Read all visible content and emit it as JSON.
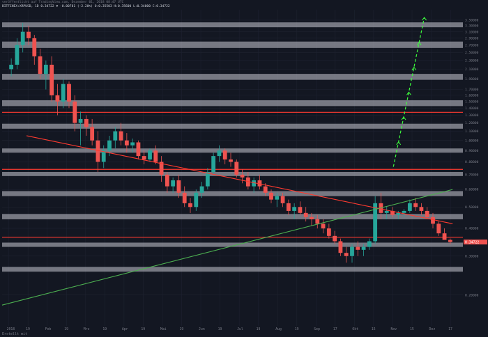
{
  "header": {
    "line1": "veröffentlicht auf TradingView.com, Dezember 01, 2018 08:47 UTC",
    "line2": "BITFINEX:XRPUSD, 1D 0.34722 ▼ -0.00781 (-2.20%) O:0.35503 H:0.35600 L:0.34000 C:0.34722"
  },
  "footer": {
    "note": "Erstellt mit"
  },
  "colors": {
    "background": "#131722",
    "zone": "#c8c8d2",
    "red_line": "#ff3b30",
    "green_line": "#4caf50",
    "arrow": "#3dff3d",
    "up": "#26a69a",
    "down": "#ef5350"
  },
  "price_badges": {
    "top": "3.50000",
    "current": "0.34722"
  },
  "chart_data": {
    "type": "candlestick",
    "symbol": "XRPUSD",
    "exchange": "BITFINEX",
    "timeframe": "1D",
    "yscale": "log",
    "ylim": [
      0.145,
      3.9
    ],
    "x_ticks": [
      "2018",
      "19",
      "Feb",
      "19",
      "Mrz",
      "19",
      "Apr",
      "19",
      "Mai",
      "19",
      "Jun",
      "19",
      "Jul",
      "19",
      "Aug",
      "19",
      "Sep",
      "17",
      "Okt",
      "15",
      "Nov",
      "15",
      "Dez",
      "17"
    ],
    "y_ticks": [
      "3.50000",
      "3.30000",
      "3.10000",
      "2.90000",
      "2.70000",
      "2.50000",
      "2.30000",
      "2.10000",
      "1.90000",
      "1.70000",
      "1.60000",
      "1.50000",
      "1.40000",
      "1.30000",
      "1.20000",
      "1.10000",
      "1.00000",
      "0.90000",
      "0.80000",
      "0.70000",
      "0.60000",
      "0.50000",
      "0.40000",
      "0.30000",
      "0.20000"
    ],
    "zones": [
      [
        3.25,
        3.42
      ],
      [
        2.62,
        2.8
      ],
      [
        1.88,
        2.0
      ],
      [
        1.43,
        1.52
      ],
      [
        1.13,
        1.19
      ],
      [
        0.88,
        0.92
      ],
      [
        0.69,
        0.72
      ],
      [
        0.56,
        0.59
      ],
      [
        0.44,
        0.465
      ],
      [
        0.33,
        0.345
      ],
      [
        0.255,
        0.268
      ]
    ],
    "horizontal_lines": [
      1.34,
      0.74,
      0.365
    ],
    "trend_lines": [
      {
        "color": "red",
        "from": [
          "2018-01-20",
          1.05
        ],
        "to": [
          "2018-12-17",
          0.42
        ]
      },
      {
        "color": "green",
        "from": [
          "2018-01-01",
          0.18
        ],
        "to": [
          "2018-12-17",
          0.6
        ]
      }
    ],
    "projection": {
      "style": "dashed-arrow",
      "from": [
        "2018-11-01",
        0.76
      ],
      "to": [
        "2018-11-25",
        3.6
      ]
    },
    "candles": [
      [
        2.1,
        2.35,
        1.95,
        2.2
      ],
      [
        2.2,
        2.9,
        2.1,
        2.7
      ],
      [
        2.7,
        3.4,
        2.5,
        3.1
      ],
      [
        3.1,
        3.3,
        2.7,
        2.9
      ],
      [
        2.9,
        3.0,
        2.2,
        2.4
      ],
      [
        2.4,
        2.6,
        1.9,
        2.0
      ],
      [
        2.0,
        2.3,
        1.7,
        2.2
      ],
      [
        2.2,
        2.4,
        1.5,
        1.6
      ],
      [
        1.6,
        1.8,
        1.3,
        1.5
      ],
      [
        1.5,
        1.9,
        1.4,
        1.8
      ],
      [
        1.8,
        1.85,
        1.4,
        1.5
      ],
      [
        1.5,
        1.6,
        1.1,
        1.2
      ],
      [
        1.2,
        1.35,
        0.95,
        1.25
      ],
      [
        1.25,
        1.3,
        1.05,
        1.15
      ],
      [
        1.15,
        1.25,
        0.95,
        1.0
      ],
      [
        1.0,
        1.1,
        0.72,
        0.8
      ],
      [
        0.8,
        0.95,
        0.75,
        0.9
      ],
      [
        0.9,
        1.05,
        0.85,
        1.0
      ],
      [
        1.0,
        1.15,
        0.92,
        1.1
      ],
      [
        1.1,
        1.2,
        0.95,
        1.0
      ],
      [
        1.0,
        1.08,
        0.88,
        0.95
      ],
      [
        0.95,
        1.02,
        0.88,
        0.98
      ],
      [
        0.98,
        1.0,
        0.82,
        0.85
      ],
      [
        0.85,
        0.9,
        0.78,
        0.82
      ],
      [
        0.82,
        0.92,
        0.8,
        0.9
      ],
      [
        0.9,
        0.95,
        0.78,
        0.8
      ],
      [
        0.8,
        0.85,
        0.65,
        0.7
      ],
      [
        0.7,
        0.72,
        0.58,
        0.62
      ],
      [
        0.62,
        0.68,
        0.58,
        0.66
      ],
      [
        0.66,
        0.7,
        0.55,
        0.58
      ],
      [
        0.58,
        0.62,
        0.5,
        0.52
      ],
      [
        0.52,
        0.55,
        0.47,
        0.5
      ],
      [
        0.5,
        0.6,
        0.48,
        0.58
      ],
      [
        0.58,
        0.65,
        0.55,
        0.62
      ],
      [
        0.62,
        0.75,
        0.6,
        0.72
      ],
      [
        0.72,
        0.88,
        0.7,
        0.85
      ],
      [
        0.85,
        0.95,
        0.8,
        0.9
      ],
      [
        0.9,
        0.92,
        0.78,
        0.82
      ],
      [
        0.82,
        0.88,
        0.76,
        0.8
      ],
      [
        0.8,
        0.82,
        0.68,
        0.7
      ],
      [
        0.7,
        0.74,
        0.64,
        0.68
      ],
      [
        0.68,
        0.72,
        0.6,
        0.62
      ],
      [
        0.62,
        0.68,
        0.58,
        0.66
      ],
      [
        0.66,
        0.7,
        0.6,
        0.62
      ],
      [
        0.62,
        0.64,
        0.56,
        0.58
      ],
      [
        0.58,
        0.6,
        0.52,
        0.54
      ],
      [
        0.54,
        0.58,
        0.5,
        0.56
      ],
      [
        0.56,
        0.58,
        0.5,
        0.52
      ],
      [
        0.52,
        0.54,
        0.46,
        0.48
      ],
      [
        0.48,
        0.52,
        0.44,
        0.5
      ],
      [
        0.5,
        0.53,
        0.46,
        0.47
      ],
      [
        0.47,
        0.5,
        0.43,
        0.45
      ],
      [
        0.45,
        0.47,
        0.41,
        0.44
      ],
      [
        0.44,
        0.46,
        0.4,
        0.42
      ],
      [
        0.42,
        0.44,
        0.38,
        0.4
      ],
      [
        0.4,
        0.42,
        0.36,
        0.37
      ],
      [
        0.37,
        0.39,
        0.34,
        0.35
      ],
      [
        0.35,
        0.36,
        0.3,
        0.31
      ],
      [
        0.31,
        0.33,
        0.28,
        0.3
      ],
      [
        0.3,
        0.34,
        0.28,
        0.33
      ],
      [
        0.33,
        0.35,
        0.3,
        0.32
      ],
      [
        0.32,
        0.34,
        0.3,
        0.33
      ],
      [
        0.33,
        0.36,
        0.32,
        0.35
      ],
      [
        0.35,
        0.56,
        0.34,
        0.52
      ],
      [
        0.52,
        0.58,
        0.44,
        0.47
      ],
      [
        0.47,
        0.5,
        0.44,
        0.48
      ],
      [
        0.48,
        0.5,
        0.45,
        0.46
      ],
      [
        0.46,
        0.48,
        0.44,
        0.47
      ],
      [
        0.47,
        0.49,
        0.45,
        0.48
      ],
      [
        0.48,
        0.54,
        0.47,
        0.52
      ],
      [
        0.52,
        0.55,
        0.48,
        0.5
      ],
      [
        0.5,
        0.52,
        0.46,
        0.48
      ],
      [
        0.48,
        0.5,
        0.44,
        0.45
      ],
      [
        0.45,
        0.47,
        0.4,
        0.42
      ],
      [
        0.42,
        0.43,
        0.37,
        0.38
      ],
      [
        0.38,
        0.4,
        0.36,
        0.355
      ],
      [
        0.355,
        0.36,
        0.34,
        0.347
      ]
    ]
  }
}
